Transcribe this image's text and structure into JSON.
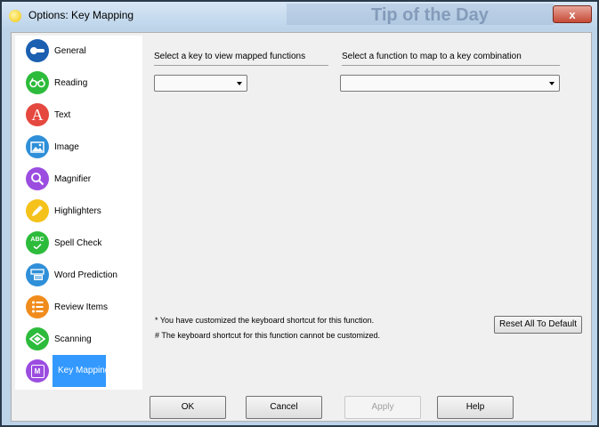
{
  "window": {
    "title": "Options: Key Mapping",
    "close_glyph": "x",
    "background_window_text": "Tip of the Day"
  },
  "sidebar": {
    "items": [
      {
        "label": "General",
        "icon": "toggle-icon",
        "color": "#1b5fb0"
      },
      {
        "label": "Reading",
        "icon": "glasses-icon",
        "color": "#2dbb3b"
      },
      {
        "label": "Text",
        "icon": "letter-a-icon",
        "color": "#e5483f",
        "glyph": "A"
      },
      {
        "label": "Image",
        "icon": "picture-icon",
        "color": "#2f8fd8"
      },
      {
        "label": "Magnifier",
        "icon": "magnifier-icon",
        "color": "#9b4de0"
      },
      {
        "label": "Highlighters",
        "icon": "highlighter-icon",
        "color": "#f4c21b"
      },
      {
        "label": "Spell Check",
        "icon": "abc-check-icon",
        "color": "#2dbb3b",
        "glyph": "ABC"
      },
      {
        "label": "Word Prediction",
        "icon": "word-prediction-icon",
        "color": "#2f8fd8"
      },
      {
        "label": "Review Items",
        "icon": "list-icon",
        "color": "#f08c1d"
      },
      {
        "label": "Scanning",
        "icon": "scan-icon",
        "color": "#2dbb3b"
      },
      {
        "label": "Key Mapping",
        "icon": "key-mapping-icon",
        "color": "#9b4de0",
        "glyph": "M"
      }
    ],
    "active_index": 10,
    "active_color": "#3399ff"
  },
  "main": {
    "key_header": "Select a key to view mapped functions",
    "function_header": "Select a function to map to a key combination",
    "key_select_value": "",
    "function_select_value": "",
    "note_customized": "* You have customized the keyboard shortcut for this function.",
    "note_fixed": "# The keyboard shortcut for this function cannot be customized.",
    "reset_label": "Reset All To Default"
  },
  "footer": {
    "ok_label": "OK",
    "cancel_label": "Cancel",
    "apply_label": "Apply",
    "help_label": "Help"
  }
}
